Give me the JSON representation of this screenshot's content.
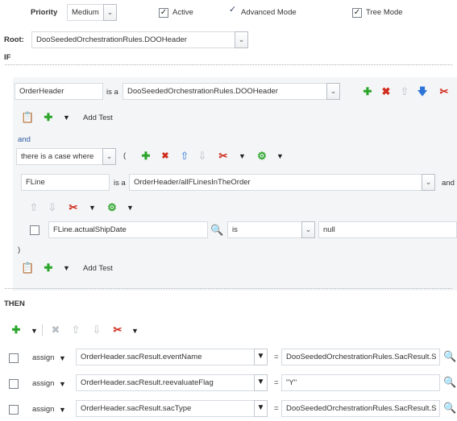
{
  "header": {
    "priority_label": "Priority",
    "priority_value": "Medium",
    "active_label": "Active",
    "active_checked": true,
    "advanced_label": "Advanced Mode",
    "advanced_checked": true,
    "tree_label": "Tree Mode",
    "tree_checked": true
  },
  "root": {
    "label": "Root:",
    "value": "DooSeededOrchestrationRules.DOOHeader"
  },
  "if_section": {
    "label": "IF",
    "condition1": {
      "variable": "OrderHeader",
      "is_a": "is a",
      "type": "DooSeededOrchestrationRules.DOOHeader"
    },
    "add_test_label": "Add Test",
    "and_label": "and",
    "case_select": "there is a case where",
    "open_paren": "(",
    "condition2": {
      "variable": "FLine",
      "is_a": "is a",
      "type": "OrderHeader/allFLinesInTheOrder",
      "trailing": "and"
    },
    "test": {
      "field": "FLine.actualShipDate",
      "operator": "is",
      "value": "null"
    },
    "close_paren": ")",
    "add_test_label2": "Add Test"
  },
  "then_section": {
    "label": "THEN",
    "actions": [
      {
        "verb": "assign",
        "target": "OrderHeader.sacResult.eventName",
        "eq": "=",
        "value": "DooSeededOrchestrationRules.SacResult.S"
      },
      {
        "verb": "assign",
        "target": "OrderHeader.sacResult.reevaluateFlag",
        "eq": "=",
        "value": "\"Y\""
      },
      {
        "verb": "assign",
        "target": "OrderHeader.sacResult.sacType",
        "eq": "=",
        "value": "DooSeededOrchestrationRules.SacResult.S"
      }
    ]
  },
  "icons": {
    "add": "plus-icon",
    "delete": "x-icon",
    "move_up": "arrow-up-icon",
    "move_down": "arrow-down-icon",
    "cut": "scissors-icon",
    "copy": "clipboard-icon",
    "gear": "gear-icon",
    "search": "magnifier-icon"
  },
  "colors": {
    "add_green": "#2aa52a",
    "delete_red": "#d02a1a",
    "arrow_blue": "#2c74d8",
    "panel_bg": "#f4f5f6"
  }
}
